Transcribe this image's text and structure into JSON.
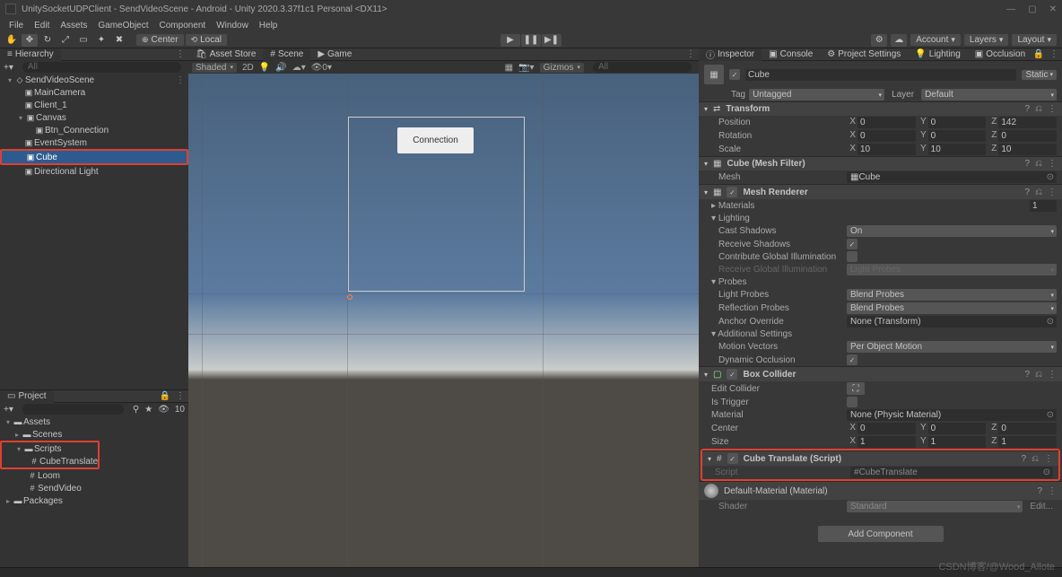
{
  "title": "UnitySocketUDPClient - SendVideoScene - Android - Unity 2020.3.37f1c1 Personal <DX11>",
  "menu": [
    "File",
    "Edit",
    "Assets",
    "GameObject",
    "Component",
    "Window",
    "Help"
  ],
  "toolbar": {
    "center": "Center",
    "local": "Local"
  },
  "top_right": {
    "account": "Account",
    "layers": "Layers",
    "layout": "Layout"
  },
  "hierarchy": {
    "tab": "Hierarchy",
    "search_placeholder": "All",
    "scene": "SendVideoScene",
    "items": [
      "MainCamera",
      "Client_1",
      "Canvas",
      "Btn_Connection",
      "EventSystem",
      "Cube",
      "Directional Light"
    ]
  },
  "project": {
    "tab": "Project",
    "count": "10",
    "root": "Assets",
    "folders": [
      "Scenes",
      "Scripts"
    ],
    "scripts": [
      "CubeTranslate",
      "Loom",
      "SendVideo"
    ],
    "packages": "Packages"
  },
  "scene": {
    "assetstore": "Asset Store",
    "scene": "Scene",
    "game": "Game",
    "shaded": "Shaded",
    "mode": "2D",
    "gizmos": "Gizmos",
    "all": "All",
    "button": "Connection"
  },
  "inspector": {
    "tab": "Inspector",
    "console": "Console",
    "projset": "Project Settings",
    "lighting": "Lighting",
    "occlusion": "Occlusion",
    "name": "Cube",
    "static": "Static",
    "tag_lbl": "Tag",
    "tag": "Untagged",
    "layer_lbl": "Layer",
    "layer": "Default",
    "transform": {
      "title": "Transform",
      "pos": "Position",
      "rot": "Rotation",
      "scale": "Scale",
      "px": "0",
      "py": "0",
      "pz": "142",
      "rx": "0",
      "ry": "0",
      "rz": "0",
      "sx": "10",
      "sy": "10",
      "sz": "10"
    },
    "meshfilter": {
      "title": "Cube (Mesh Filter)",
      "mesh_lbl": "Mesh",
      "mesh": "Cube"
    },
    "meshrenderer": {
      "title": "Mesh Renderer",
      "materials": "Materials",
      "mat_count": "1",
      "lighting": "Lighting",
      "cast_lbl": "Cast Shadows",
      "cast": "On",
      "recv": "Receive Shadows",
      "cgi": "Contribute Global Illumination",
      "rgi": "Receive Global Illumination",
      "rgi_val": "Light Probes",
      "probes": "Probes",
      "lprobes": "Light Probes",
      "lprobes_v": "Blend Probes",
      "rprobes": "Reflection Probes",
      "rprobes_v": "Blend Probes",
      "anchor": "Anchor Override",
      "anchor_v": "None (Transform)",
      "addset": "Additional Settings",
      "mvec": "Motion Vectors",
      "mvec_v": "Per Object Motion",
      "dyno": "Dynamic Occlusion"
    },
    "boxcol": {
      "title": "Box Collider",
      "edit": "Edit Collider",
      "trig": "Is Trigger",
      "mat_lbl": "Material",
      "mat": "None (Physic Material)",
      "center": "Center",
      "size": "Size",
      "cx": "0",
      "cy": "0",
      "cz": "0",
      "sx": "1",
      "sy": "1",
      "sz": "1"
    },
    "script": {
      "title": "Cube Translate (Script)",
      "lbl": "Script",
      "val": "CubeTranslate"
    },
    "material": {
      "title": "Default-Material (Material)",
      "shader_lbl": "Shader",
      "shader": "Standard",
      "edit": "Edit..."
    },
    "add": "Add Component"
  },
  "watermark": "CSDN博客/@Wood_Allote"
}
